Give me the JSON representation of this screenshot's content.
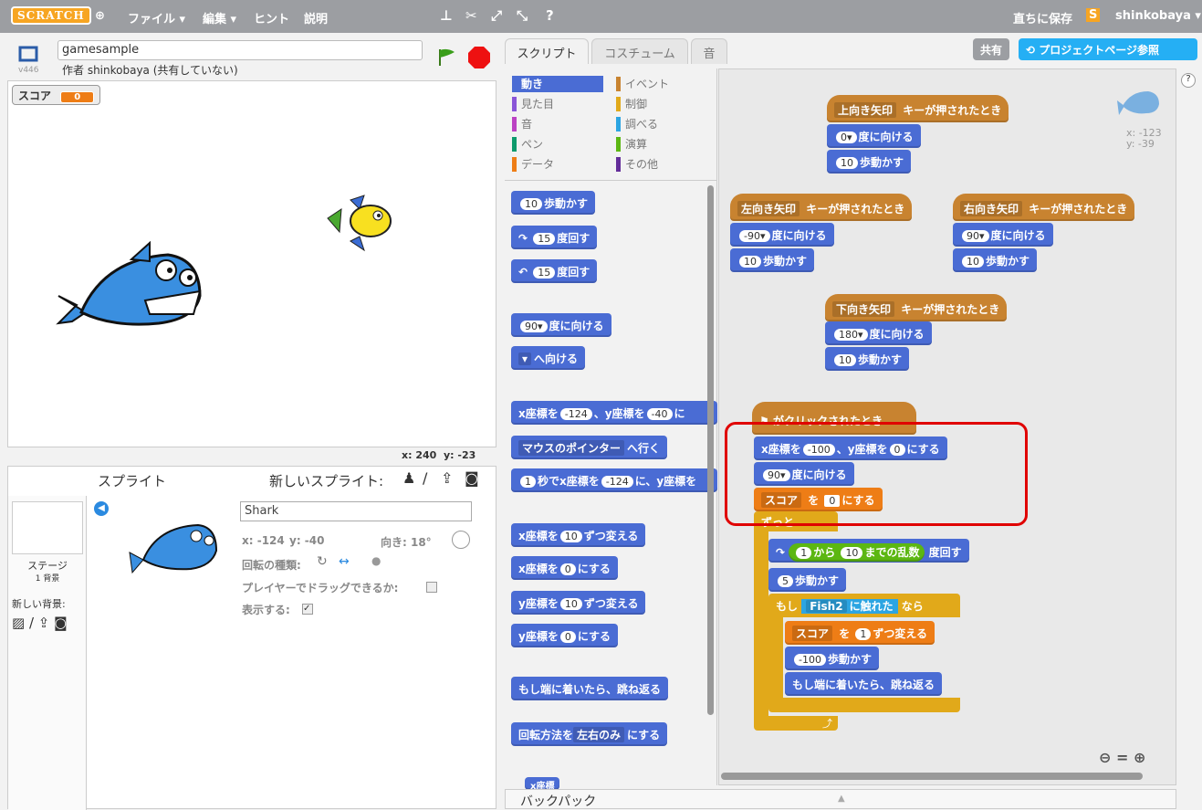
{
  "menubar": {
    "logo": "SCRATCH",
    "items": [
      "ファイル ▾",
      "編集 ▾",
      "ヒント",
      "説明"
    ],
    "save": "直ちに保存",
    "user": "shinkobaya ▾"
  },
  "project": {
    "name": "gamesample",
    "version": "v446",
    "author": "作者 shinkobaya (共有していない)",
    "score_label": "スコア",
    "score_value": "0"
  },
  "stage": {
    "x_label": "x:",
    "x": "240",
    "y_label": "y:",
    "y": "-23"
  },
  "tabs": [
    "スクリプト",
    "コスチューム",
    "音"
  ],
  "top_buttons": {
    "share": "共有",
    "project_page": "プロジェクトページ参照"
  },
  "categories": [
    {
      "label": "動き",
      "color": "#4a6cd4"
    },
    {
      "label": "見た目",
      "color": "#8a55d7"
    },
    {
      "label": "音",
      "color": "#bb42c3"
    },
    {
      "label": "ペン",
      "color": "#0e9a6c"
    },
    {
      "label": "データ",
      "color": "#ee7d16"
    },
    {
      "label": "イベント",
      "color": "#c88330"
    },
    {
      "label": "制御",
      "color": "#e1a91a"
    },
    {
      "label": "調べる",
      "color": "#2ca5e2"
    },
    {
      "label": "演算",
      "color": "#5cb712"
    },
    {
      "label": "その他",
      "color": "#632d99"
    }
  ],
  "palette_blocks": [
    "歩動かす",
    "度回す",
    "度回す",
    "度に向ける",
    "へ向ける",
    "x座標を",
    "、y座標を",
    "に",
    "マウスのポインター",
    "へ行く",
    "秒でx座標を",
    "に、y座標を",
    "x座標を",
    "ずつ変える",
    "x座標を",
    "にする",
    "y座標を",
    "ずつ変える",
    "y座標を",
    "にする",
    "もし端に着いたら、跳ね返る",
    "回転方法を",
    "左右のみ",
    "にする",
    "x座標"
  ],
  "palette_nums": [
    "10",
    "15",
    "15",
    "90▾",
    "-124",
    "-40",
    "1",
    "-124",
    "10",
    "0",
    "10",
    "0"
  ],
  "sprites": {
    "title": "スプライト",
    "new": "新しいスプライト:",
    "stage": "ステージ",
    "stage_sub": "1 背景",
    "new_bg": "新しい背景:",
    "name": "Shark",
    "x": "x: -124",
    "y": "y: -40",
    "dir": "向き: 18°",
    "rot": "回転の種類:",
    "drag": "プレイヤーでドラッグできるか:",
    "show": "表示する:"
  },
  "scripts": {
    "sprite_x": "x: -123",
    "sprite_y": "y: -39",
    "up_hat": "上向き矢印",
    "key_pressed": "キーが押されたとき",
    "left_hat": "左向き矢印",
    "right_hat": "右向き矢印",
    "down_hat": "下向き矢印",
    "point": "度に向ける",
    "move": "歩動かす",
    "n0": "0▾",
    "n10": "10",
    "nm90": "-90▾",
    "n90": "90▾",
    "n180": "180▾",
    "flag_hat": "がクリックされたとき",
    "goto_x": "x座標を",
    "goto_y": "、y座標を",
    "goto_end": "にする",
    "nm100": "-100",
    "nz": "0",
    "score": "スコア",
    "set_to": "を",
    "set_end": "にする",
    "forever": "ずっと",
    "turn": "度回す",
    "rand_from": "から",
    "rand_to": "までの乱数",
    "n1": "1",
    "n5": "5",
    "if": "もし",
    "fish": "Fish2",
    "touching": "に触れた",
    "then": "なら",
    "change_by": "ずつ変える",
    "bounce": "もし端に着いたら、跳ね返る"
  },
  "backpack": "バックパック"
}
